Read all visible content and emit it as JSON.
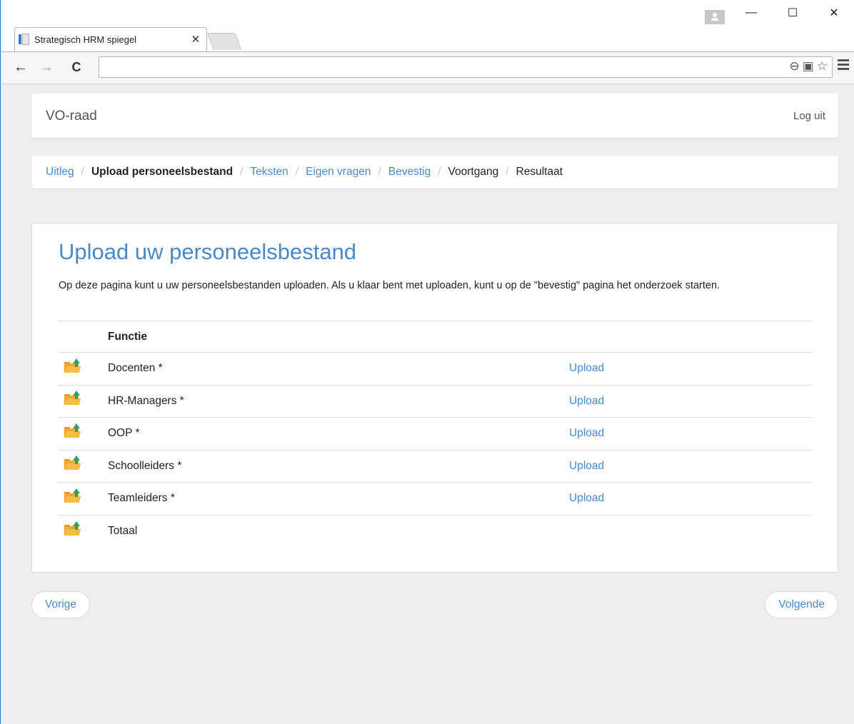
{
  "browser": {
    "tab_title": "Strategisch HRM spiegel",
    "tab_close": "✕",
    "back": "←",
    "forward": "→",
    "reload": "C",
    "url": "",
    "win_minimize": "—",
    "win_maximize": "☐",
    "win_close": "✕",
    "zoom_icon": "⊖",
    "translate_icon": "▣",
    "star_icon": "☆"
  },
  "header": {
    "brand": "VO-raad",
    "logout": "Log uit"
  },
  "breadcrumb": [
    {
      "label": "Uitleg",
      "state": "link"
    },
    {
      "label": "Upload personeelsbestand",
      "state": "active"
    },
    {
      "label": "Teksten",
      "state": "link"
    },
    {
      "label": "Eigen vragen",
      "state": "link"
    },
    {
      "label": "Bevestig",
      "state": "link"
    },
    {
      "label": "Voortgang",
      "state": "plain"
    },
    {
      "label": "Resultaat",
      "state": "plain"
    }
  ],
  "breadcrumb_separator": "/",
  "main": {
    "title": "Upload uw personeelsbestand",
    "description": "Op deze pagina kunt u uw personeelsbestanden uploaden. Als u klaar bent met uploaden, kunt u op de \"bevestig\" pagina het onderzoek starten.",
    "table": {
      "column_functie": "Functie",
      "rows": [
        {
          "functie": "Docenten *",
          "action": "Upload"
        },
        {
          "functie": "HR-Managers *",
          "action": "Upload"
        },
        {
          "functie": "OOP *",
          "action": "Upload"
        },
        {
          "functie": "Schoolleiders *",
          "action": "Upload"
        },
        {
          "functie": "Teamleiders *",
          "action": "Upload"
        },
        {
          "functie": "Totaal",
          "action": ""
        }
      ]
    }
  },
  "footer": {
    "prev": "Vorige",
    "next": "Volgende"
  },
  "colors": {
    "accent": "#4a89c8",
    "background": "#eeeeee",
    "folder": "#f0a830",
    "folder_arrow": "#2e9e6a"
  }
}
